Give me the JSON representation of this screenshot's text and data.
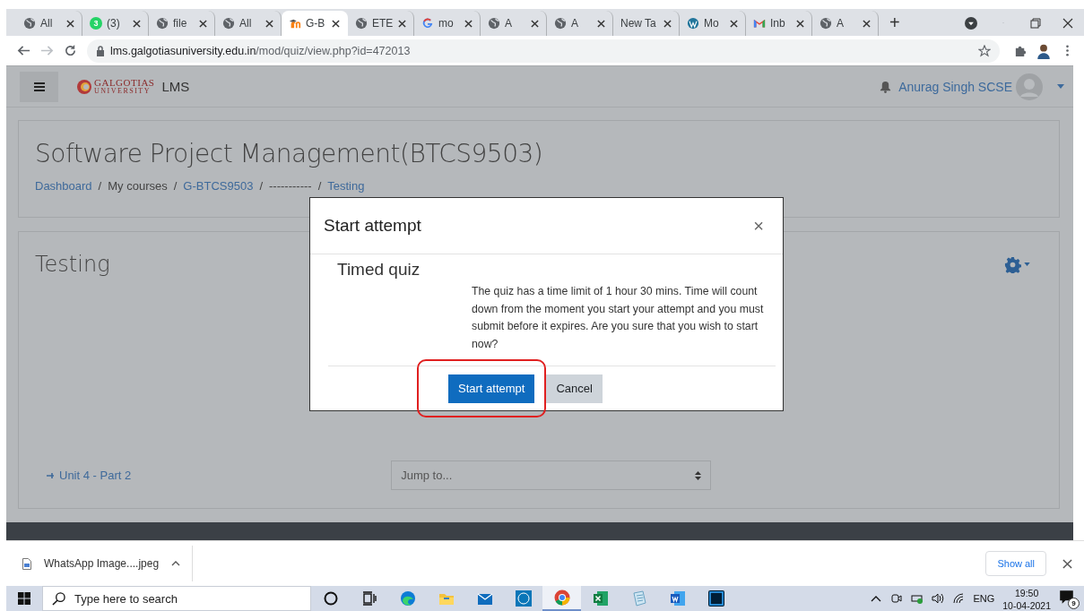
{
  "browser": {
    "tabs": [
      {
        "title": "All",
        "kind": "globe",
        "selected": false
      },
      {
        "title": "(3)",
        "kind": "chat",
        "badge": "3",
        "selected": false
      },
      {
        "title": "file",
        "kind": "globe",
        "selected": false
      },
      {
        "title": "All",
        "kind": "globe",
        "selected": false
      },
      {
        "title": "G-B",
        "kind": "course",
        "selected": true
      },
      {
        "title": "ETE",
        "kind": "globe",
        "selected": false
      },
      {
        "title": "mo",
        "kind": "search",
        "selected": false
      },
      {
        "title": "A",
        "kind": "globe",
        "selected": false
      },
      {
        "title": "A",
        "kind": "globe",
        "selected": false
      },
      {
        "title": "New Ta",
        "kind": "blank",
        "selected": false
      },
      {
        "title": "Mo",
        "kind": "blog",
        "selected": false
      },
      {
        "title": "Inb",
        "kind": "mail",
        "selected": false
      },
      {
        "title": "A",
        "kind": "globe",
        "selected": false
      }
    ],
    "new_tab": "+",
    "address": {
      "host": "lms.galgotiasuniversity.edu.in",
      "path": "/mod/quiz/view.php?id=472013"
    },
    "forward_disabled": true
  },
  "navbar": {
    "logo": {
      "line_1": "GALGOTIAS",
      "line_2": "UNIVERSITY"
    },
    "site": "LMS",
    "user": "Anurag Singh SCSE"
  },
  "header": {
    "title": "Software Project Management(BTCS9503)",
    "breadcrumbs": [
      {
        "label": "Dashboard",
        "link": true
      },
      {
        "label": "My courses",
        "link": false
      },
      {
        "label": "G-BTCS9503",
        "link": true
      },
      {
        "label": "-----------",
        "link": false
      },
      {
        "label": "Testing",
        "link": true
      }
    ],
    "separator": "/"
  },
  "main": {
    "title": "Testing",
    "prev_link": "Unit 4 - Part 2",
    "jump": {
      "placeholder": "Jump to..."
    }
  },
  "modal": {
    "title": "Start attempt",
    "close": "×",
    "heading": "Timed quiz",
    "message": "The quiz has a time limit of 1 hour 30 mins. Time will count down from the moment you start your attempt and you must submit before it expires. Are you sure that you wish to start now?",
    "buttons": [
      {
        "label": "Start attempt",
        "kind": "primary",
        "highlighted": true
      },
      {
        "label": "Cancel",
        "kind": "secondary",
        "highlighted": false
      }
    ]
  },
  "downloads": {
    "file": "WhatsApp Image....jpeg",
    "show_all": "Show all"
  },
  "taskbar": {
    "search": {
      "placeholder": "Type here to search"
    },
    "apps": [
      {
        "kind": "cortana",
        "selected": false
      },
      {
        "kind": "taskview",
        "selected": false
      },
      {
        "kind": "edge",
        "selected": false
      },
      {
        "kind": "folder",
        "selected": false
      },
      {
        "kind": "mail",
        "selected": false
      },
      {
        "kind": "dell",
        "selected": false
      },
      {
        "kind": "chrome",
        "selected": true
      },
      {
        "kind": "excel",
        "selected": false
      },
      {
        "kind": "notepad",
        "selected": false
      },
      {
        "kind": "word",
        "selected": false
      },
      {
        "kind": "photoshop",
        "selected": false
      }
    ],
    "language": "ENG",
    "time": "19:50",
    "date": "10-04-2021",
    "notifications": "9"
  }
}
